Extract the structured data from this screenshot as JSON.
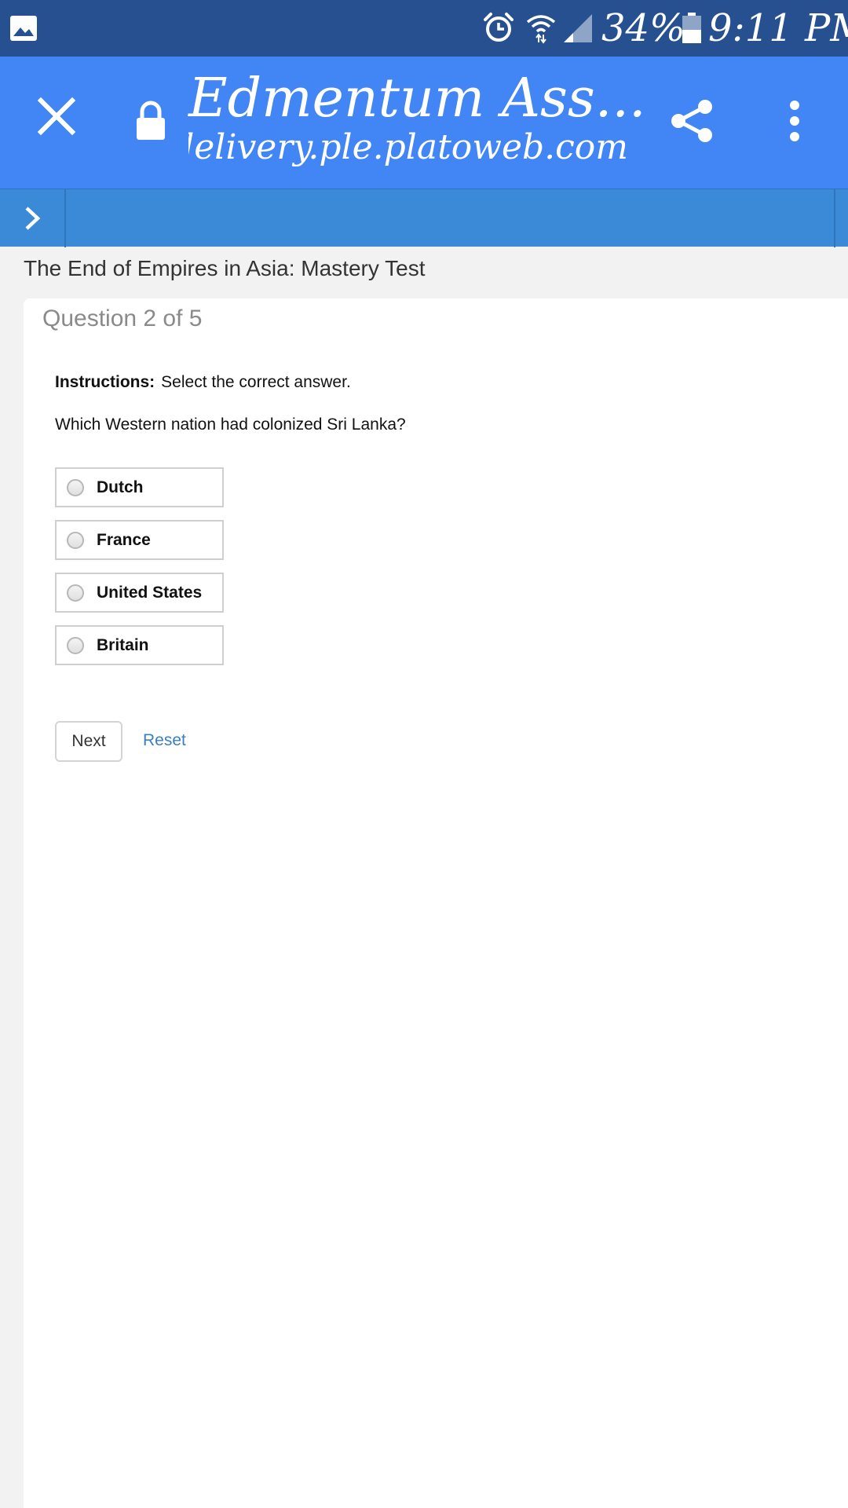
{
  "status_bar": {
    "battery_percent": "34%",
    "time": "9:11 PM",
    "icons": [
      "gallery-icon",
      "alarm-icon",
      "wifi-icon",
      "signal-icon",
      "battery-icon"
    ]
  },
  "browser": {
    "page_title": "Edmentum Ass...",
    "url": "delivery.ple.platoweb.com",
    "toolbar_color": "#4285f4",
    "status_bar_color": "#26508f"
  },
  "test": {
    "title": "The End of Empires in Asia: Mastery Test",
    "question_counter": "Question 2 of 5",
    "instructions_label": "Instructions:",
    "instructions_text": "Select the correct answer.",
    "question": "Which Western nation had colonized Sri Lanka?",
    "choices": [
      {
        "label": "Dutch",
        "selected": false
      },
      {
        "label": "France",
        "selected": false
      },
      {
        "label": "United States",
        "selected": false
      },
      {
        "label": "Britain",
        "selected": false
      }
    ],
    "next_label": "Next",
    "reset_label": "Reset"
  }
}
